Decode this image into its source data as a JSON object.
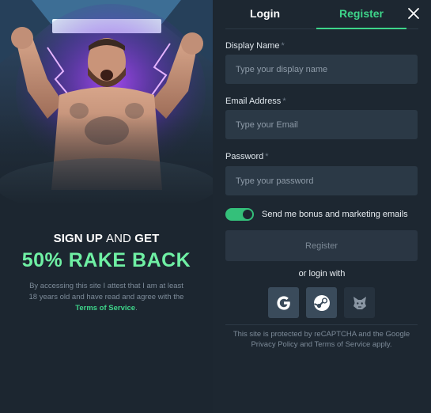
{
  "promo": {
    "headline_bold_1": "SIGN UP",
    "headline_light": "AND",
    "headline_bold_2": "GET",
    "offer": "50% RAKE BACK",
    "disclaimer_prefix": "By accessing this site I attest that I am at least 18 years old and have read and agree with the",
    "disclaimer_link": "Terms of Service",
    "disclaimer_suffix": "."
  },
  "tabs": {
    "login": "Login",
    "register": "Register",
    "active": "register"
  },
  "form": {
    "display_name": {
      "label": "Display Name",
      "required_mark": "*",
      "placeholder": "Type your display name",
      "value": ""
    },
    "email": {
      "label": "Email Address",
      "required_mark": "*",
      "placeholder": "Type your Email",
      "value": ""
    },
    "password": {
      "label": "Password",
      "required_mark": "*",
      "placeholder": "Type your password",
      "value": ""
    },
    "marketing_toggle": {
      "label": "Send me bonus and marketing emails",
      "checked": true
    },
    "submit_label": "Register"
  },
  "social": {
    "heading": "or login with",
    "providers": [
      "google-icon",
      "steam-icon",
      "metamask-icon"
    ]
  },
  "recaptcha_notice": "This site is protected by reCAPTCHA and the Google Privacy Policy and Terms of Service apply.",
  "colors": {
    "accent_green": "#3ed58a",
    "offer_green": "#6ff0a4",
    "background": "#1d2731",
    "input_bg": "#2b3946"
  }
}
